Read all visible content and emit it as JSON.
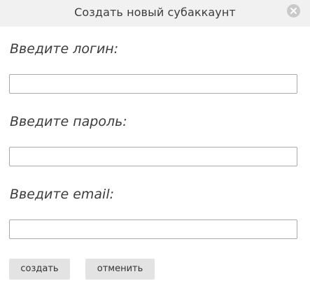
{
  "dialog": {
    "title": "Создать новый субаккаунт",
    "close_icon": "close-icon"
  },
  "form": {
    "login": {
      "label": "Введите логин:",
      "value": "",
      "placeholder": ""
    },
    "password": {
      "label": "Введите пароль:",
      "value": "",
      "placeholder": ""
    },
    "email": {
      "label": "Введите email:",
      "value": "",
      "placeholder": ""
    }
  },
  "actions": {
    "create_label": "создать",
    "cancel_label": "отменить"
  }
}
